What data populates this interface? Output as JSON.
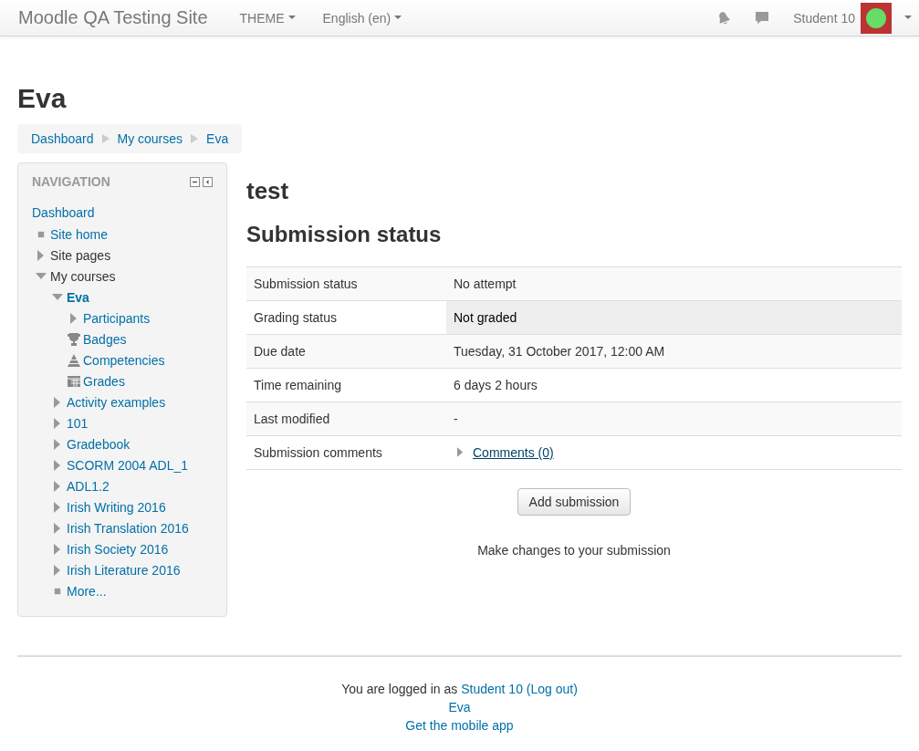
{
  "navbar": {
    "site_name": "Moodle QA Testing Site",
    "menus": [
      "THEME",
      "English (en)"
    ],
    "user_name": "Student 10"
  },
  "page_title": "Eva",
  "breadcrumb": [
    "Dashboard",
    "My courses",
    "Eva"
  ],
  "navigation": {
    "title": "NAVIGATION",
    "root": "Dashboard",
    "items": [
      {
        "label": "Site home",
        "kind": "leaf",
        "link": true,
        "current": false
      },
      {
        "label": "Site pages",
        "kind": "branch",
        "expanded": false,
        "link": false,
        "current": false
      },
      {
        "label": "My courses",
        "kind": "branch",
        "expanded": true,
        "link": false,
        "current": false,
        "children": [
          {
            "label": "Eva",
            "kind": "branch",
            "expanded": true,
            "link": true,
            "current": true,
            "children": [
              {
                "label": "Participants",
                "kind": "branch",
                "expanded": false,
                "link": true,
                "current": false
              },
              {
                "label": "Badges",
                "kind": "trophy",
                "link": true,
                "current": false
              },
              {
                "label": "Competencies",
                "kind": "pyramid",
                "link": true,
                "current": false
              },
              {
                "label": "Grades",
                "kind": "grid",
                "link": true,
                "current": false
              }
            ]
          },
          {
            "label": "Activity examples",
            "kind": "branch",
            "expanded": false,
            "link": true,
            "current": false
          },
          {
            "label": "101",
            "kind": "branch",
            "expanded": false,
            "link": true,
            "current": false
          },
          {
            "label": "Gradebook",
            "kind": "branch",
            "expanded": false,
            "link": true,
            "current": false
          },
          {
            "label": "SCORM 2004 ADL_1",
            "kind": "branch",
            "expanded": false,
            "link": true,
            "current": false
          },
          {
            "label": "ADL1.2",
            "kind": "branch",
            "expanded": false,
            "link": true,
            "current": false
          },
          {
            "label": "Irish Writing 2016",
            "kind": "branch",
            "expanded": false,
            "link": true,
            "current": false
          },
          {
            "label": "Irish Translation 2016",
            "kind": "branch",
            "expanded": false,
            "link": true,
            "current": false
          },
          {
            "label": "Irish Society 2016",
            "kind": "branch",
            "expanded": false,
            "link": true,
            "current": false
          },
          {
            "label": "Irish Literature 2016",
            "kind": "branch",
            "expanded": false,
            "link": true,
            "current": false
          },
          {
            "label": "More...",
            "kind": "leaf",
            "link": true,
            "current": false
          }
        ]
      }
    ]
  },
  "activity_title": "test",
  "section_title": "Submission status",
  "status_table": [
    {
      "label": "Submission status",
      "value": "No attempt",
      "kind": "text",
      "highlighted": false
    },
    {
      "label": "Grading status",
      "value": "Not graded",
      "kind": "text",
      "highlighted": true
    },
    {
      "label": "Due date",
      "value": "Tuesday, 31 October 2017, 12:00 AM",
      "kind": "text",
      "highlighted": false
    },
    {
      "label": "Time remaining",
      "value": "6 days 2 hours",
      "kind": "text",
      "highlighted": false
    },
    {
      "label": "Last modified",
      "value": "-",
      "kind": "text",
      "highlighted": false
    },
    {
      "label": "Submission comments",
      "value": "Comments (0)",
      "kind": "comments",
      "highlighted": false
    }
  ],
  "add_button": "Add submission",
  "add_hint": "Make changes to your submission",
  "footer": {
    "logged_in_prefix": "You are logged in as",
    "user_link": "Student 10",
    "logout_link": "(Log out)",
    "course_link": "Eva",
    "mobile_link": "Get the mobile app"
  }
}
